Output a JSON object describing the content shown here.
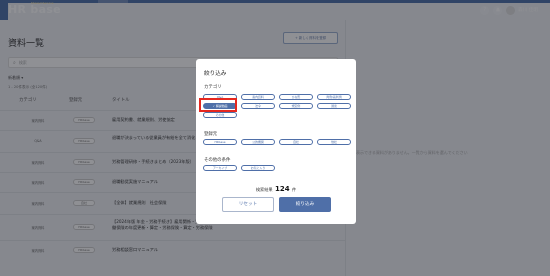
{
  "header": {
    "logo": "HR base",
    "logo_sup": "Shared Service",
    "nav": [
      "ホーム",
      "資料一覧",
      "労務管理ガイド",
      "労務マガジン",
      "チャット",
      "労務相談AI"
    ],
    "help_icon": "?",
    "user_name": "森川 佳明"
  },
  "main": {
    "title": "資料一覧",
    "add_button": "+ 新しく資料を登録",
    "search_placeholder": "検索",
    "sort_label": "新着順 ▾",
    "count_text": "1 - 20件表示 (全120件)",
    "columns": [
      "カテゴリ",
      "登録元",
      "タイトル"
    ],
    "rows": [
      {
        "category": "案内資料",
        "source": "HRbase",
        "title": "雇用契約書、就業規則、労使協定"
      },
      {
        "category": "Q&A",
        "source": "HRbase",
        "title": "退職が決まっている従業員が有給を全て消化したいと言った場合どうすればよいですか？"
      },
      {
        "category": "案内資料",
        "source": "HRbase",
        "title": "労務管理研修・手続きまとめ（2023年版）"
      },
      {
        "category": "案内資料",
        "source": "HRbase",
        "title": "退職勧奨実施マニュアル"
      },
      {
        "category": "案内資料",
        "source": "自社",
        "title": "【全体】就業規則　社会保険"
      },
      {
        "category": "案内資料",
        "source": "HRbase",
        "title": "【2024年版 年金・労務手続き】雇用関係・労使関係・労働条件関係・雇用関係・就業規則・その他各種手続き、届出・労働保険の年度更新・算定・労務保険・算定・労務保険"
      },
      {
        "category": "案内資料",
        "source": "HRbase",
        "title": "労務相談窓口マニュアル"
      }
    ],
    "empty_message": "表示できる資料がありません。一覧から資料を選んでください"
  },
  "modal": {
    "title": "絞り込み",
    "category_label": "カテゴリ",
    "categories": [
      {
        "label": "Q&A",
        "selected": false
      },
      {
        "label": "案内資料",
        "selected": false
      },
      {
        "label": "ひな形",
        "selected": false
      },
      {
        "label": "判例/裁判例",
        "selected": false
      },
      {
        "label": "✓ 解説動画",
        "selected": true
      },
      {
        "label": "法令",
        "selected": false
      },
      {
        "label": "規定例",
        "selected": false
      },
      {
        "label": "通達",
        "selected": false
      },
      {
        "label": "その他",
        "selected": false
      }
    ],
    "source_label": "登録元",
    "sources": [
      "HRbase",
      "公的機関",
      "自社",
      "他社"
    ],
    "other_label": "その他の条件",
    "others": [
      "アーカイブ",
      "お気に入り"
    ],
    "result_prefix": "検索結果",
    "result_count": "124",
    "result_suffix": "件",
    "reset_button": "リセット",
    "apply_button": "絞り込み"
  },
  "colors": {
    "header_bg": "#4a6ea8",
    "accent": "#4f6fa8",
    "highlight": "#e6271f"
  }
}
